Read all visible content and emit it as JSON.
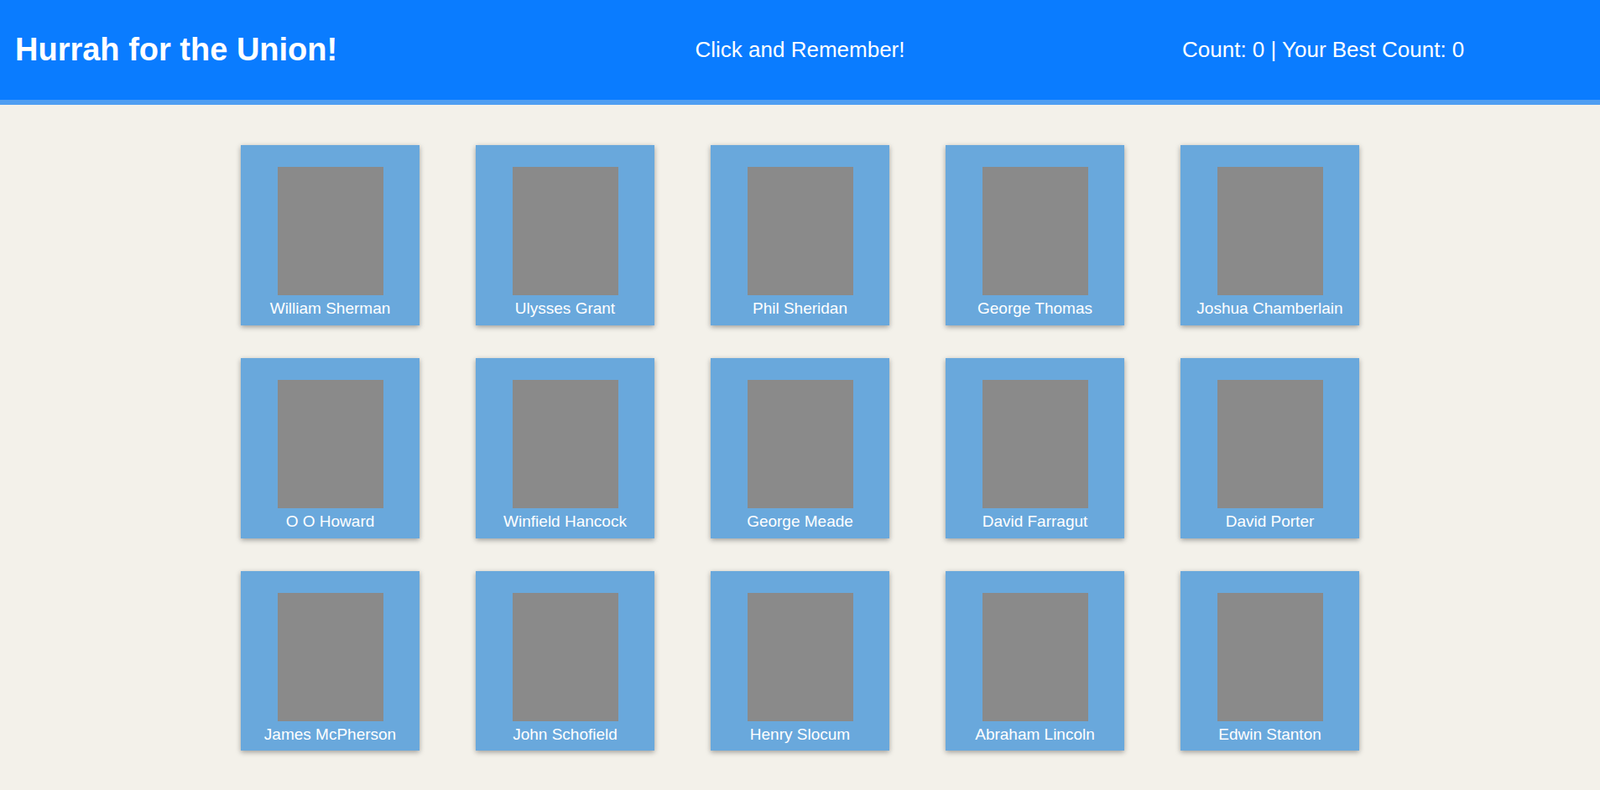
{
  "header": {
    "title": "Hurrah for the Union!",
    "subtitle": "Click and Remember!",
    "score": "Count: 0 | Your Best Count: 0"
  },
  "cards": [
    {
      "name": "William Sherman"
    },
    {
      "name": "Ulysses Grant"
    },
    {
      "name": "Phil Sheridan"
    },
    {
      "name": "George Thomas"
    },
    {
      "name": "Joshua Chamberlain"
    },
    {
      "name": "O O Howard"
    },
    {
      "name": "Winfield Hancock"
    },
    {
      "name": "George Meade"
    },
    {
      "name": "David Farragut"
    },
    {
      "name": "David Porter"
    },
    {
      "name": "James McPherson"
    },
    {
      "name": "John Schofield"
    },
    {
      "name": "Henry Slocum"
    },
    {
      "name": "Abraham Lincoln"
    },
    {
      "name": "Edwin Stanton"
    }
  ]
}
